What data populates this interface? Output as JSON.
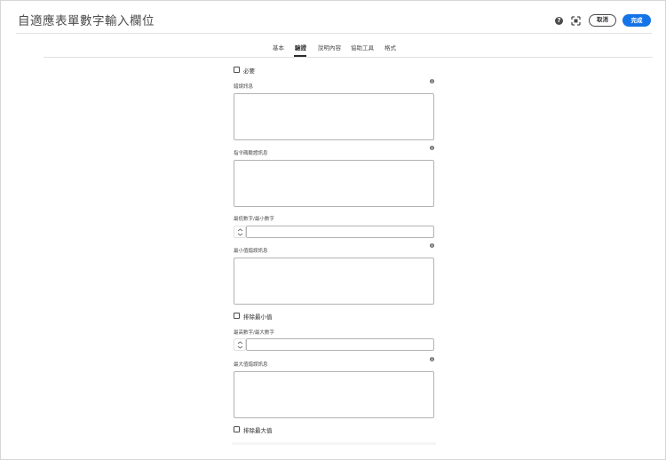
{
  "header": {
    "title": "自適應表單數字輸入欄位",
    "help_icon": "help-icon",
    "fullscreen_icon": "fullscreen-icon",
    "cancel_label": "取消",
    "done_label": "完成",
    "accent_color": "#1473e6"
  },
  "tabs": [
    {
      "label": "基本"
    },
    {
      "label": "驗證",
      "active": true
    },
    {
      "label": "說明內容"
    },
    {
      "label": "協助工具"
    },
    {
      "label": "格式"
    }
  ],
  "form": {
    "required_label": "必要",
    "error_message_label": "錯誤訊息",
    "script_error_label": "指令碼驗證訊息",
    "min_number_label": "最低數字/最小數字",
    "min_error_label": "最小值錯誤訊息",
    "exclude_min_label": "排除最小值",
    "max_number_label": "最高數字/最大數字",
    "max_error_label": "最大值錯誤訊息",
    "exclude_max_label": "排除最大值",
    "info_icon": "info-icon",
    "stepper_icon": "stepper-icon"
  }
}
